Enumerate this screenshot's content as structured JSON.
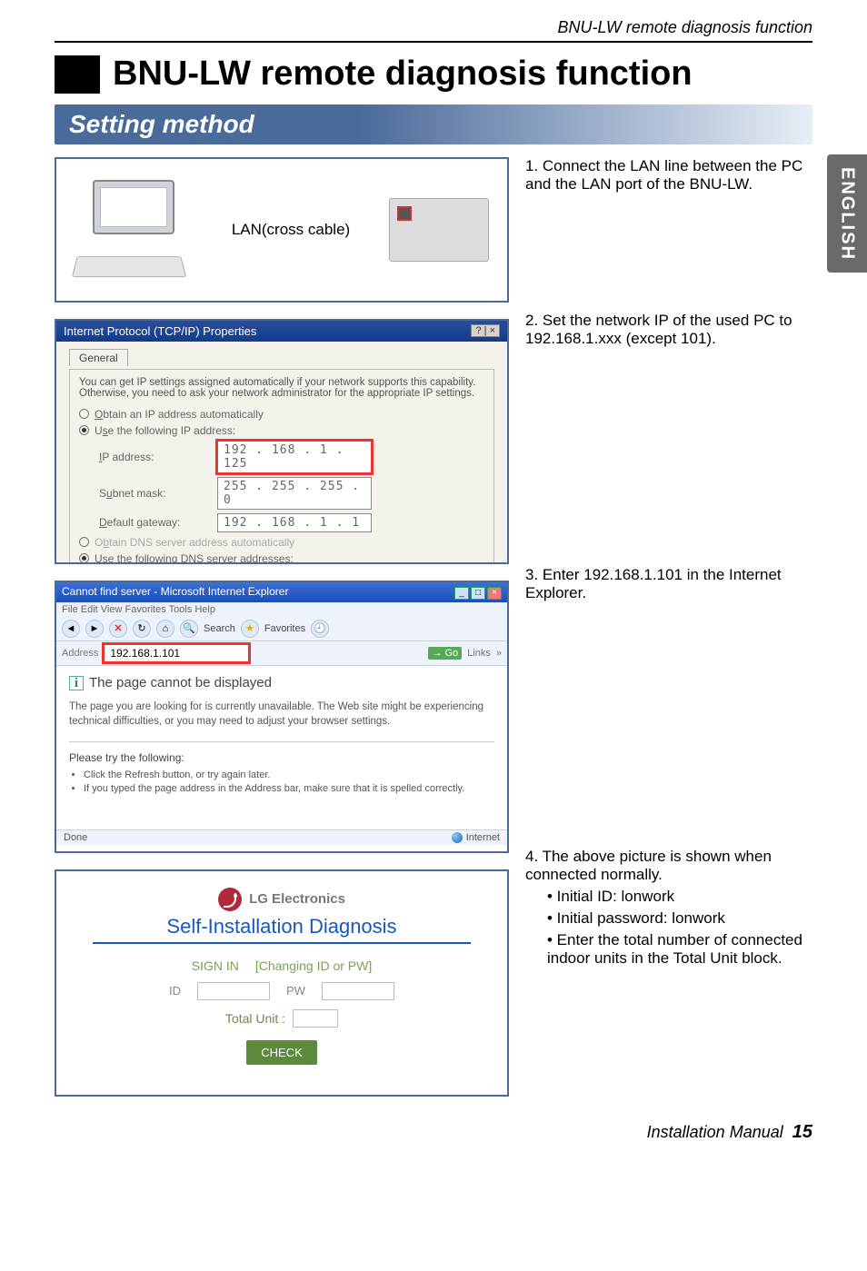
{
  "header": {
    "top_label": "BNU-LW remote diagnosis function",
    "title": "BNU-LW remote diagnosis function",
    "section": "Setting method"
  },
  "side_tab": "ENGLISH",
  "p1": {
    "cable_label": "LAN(cross cable)"
  },
  "p2": {
    "win_title": "Internet Protocol (TCP/IP) Properties",
    "win_close": "? | ×",
    "tab": "General",
    "desc": "You can get IP settings assigned automatically if your network supports this capability. Otherwise, you need to ask your network administrator for the appropriate IP settings.",
    "r_auto": "Obtain an IP address automatically",
    "r_manual": "Use the following IP address:",
    "ip_lbl": "IP address:",
    "ip_val": "192 . 168 .  1 . 125",
    "sm_lbl": "Subnet mask:",
    "sm_val": "255 . 255 . 255 .  0",
    "gw_lbl": "Default gateway:",
    "gw_val": "192 . 168 .  1 .  1",
    "r_dns_auto": "Obtain DNS server address automatically",
    "r_dns_manual": "Use the following DNS server addresses:"
  },
  "p3": {
    "title": "Cannot find server - Microsoft Internet Explorer",
    "menu": "File   Edit   View   Favorites   Tools   Help",
    "tb_search": "Search",
    "tb_fav": "Favorites",
    "addr_lbl": "Address",
    "addr_val": "192.168.1.101",
    "go": "Go",
    "links": "Links",
    "page_h": "The page cannot be displayed",
    "page_p": "The page you are looking for is currently unavailable. The Web site might be experiencing technical difficulties, or you may need to adjust your browser settings.",
    "try_h": "Please try the following:",
    "try_1": "Click the Refresh button, or try again later.",
    "try_2": "If you typed the page address in the Address bar, make sure that it is spelled correctly.",
    "status_done": "Done",
    "status_net": "Internet"
  },
  "p4": {
    "brand": "LG Electronics",
    "self_title": "Self-Installation Diagnosis",
    "signin": "SIGN IN",
    "changing": "[Changing ID or PW]",
    "id_lbl": "ID",
    "pw_lbl": "PW",
    "total_lbl": "Total Unit :",
    "check": "CHECK"
  },
  "steps": {
    "s1": "1. Connect the LAN line between the PC and the LAN port of the BNU-LW.",
    "s2": "2. Set the network IP of the used PC to 192.168.1.xxx (except 101).",
    "s3": "3. Enter 192.168.1.101 in the Internet Explorer.",
    "s4": "4. The above picture is shown when connected normally.",
    "s4_b1": "• Initial ID: lonwork",
    "s4_b2": "• Initial password: lonwork",
    "s4_b3": "• Enter the total number of connected indoor units in the Total Unit block."
  },
  "footer": {
    "label": "Installation Manual",
    "page": "15"
  }
}
